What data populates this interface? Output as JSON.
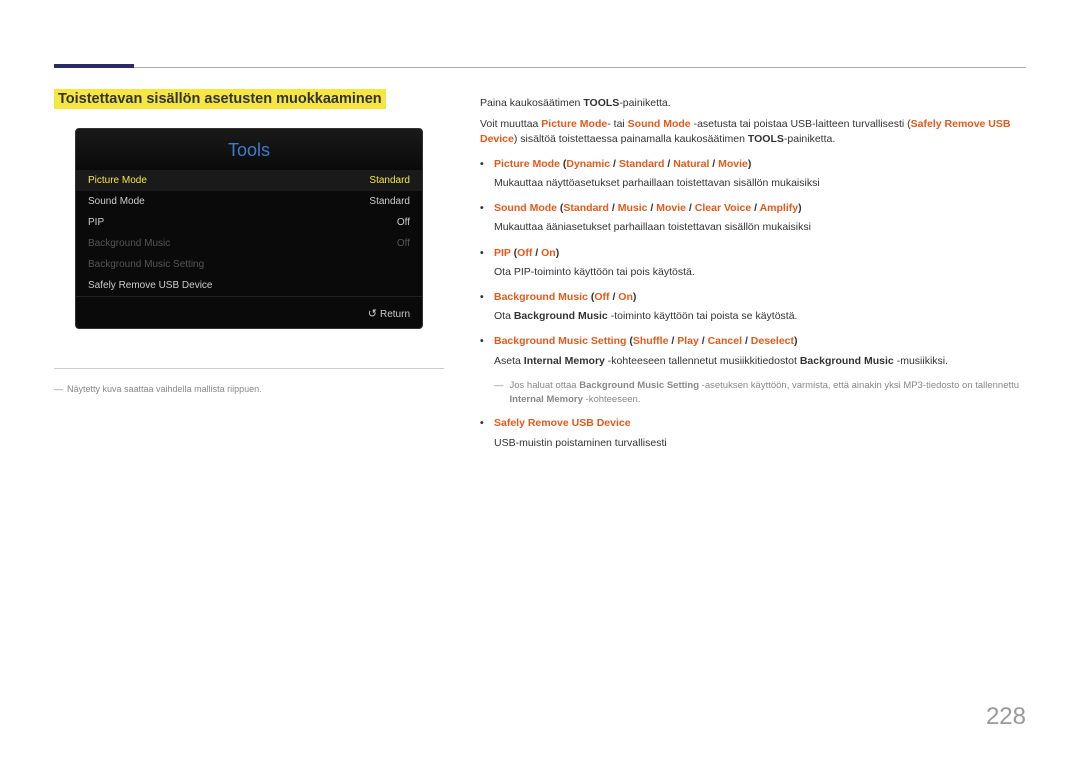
{
  "heading": "Toistettavan sisällön asetusten muokkaaminen",
  "tools": {
    "title": "Tools",
    "rows": [
      {
        "label": "Picture Mode",
        "value": "Standard",
        "cls": "highlight"
      },
      {
        "label": "Sound Mode",
        "value": "Standard",
        "cls": ""
      },
      {
        "label": "PIP",
        "value": "Off",
        "cls": ""
      },
      {
        "label": "Background Music",
        "value": "Off",
        "cls": "dim"
      },
      {
        "label": "Background Music Setting",
        "value": "",
        "cls": "dim"
      },
      {
        "label": "Safely Remove USB Device",
        "value": "",
        "cls": ""
      }
    ],
    "return": "Return"
  },
  "footnote_left": "Näytetty kuva saattaa vaihdella mallista riippuen.",
  "intro": {
    "l1a": "Paina kaukosäätimen ",
    "l1b": "TOOLS",
    "l1c": "-painiketta.",
    "l2a": "Voit muuttaa ",
    "l2b": "Picture Mode",
    "l2c": "- tai ",
    "l2d": "Sound Mode",
    "l2e": " -asetusta tai poistaa USB-laitteen turvallisesti (",
    "l2f": "Safely Remove USB Device",
    "l2g": ") sisältöä toistettaessa painamalla kaukosäätimen ",
    "l2h": "TOOLS",
    "l2i": "-painiketta."
  },
  "bullets": {
    "b1": {
      "t1": "Picture Mode",
      "p1": " (",
      "t2": "Dynamic",
      "s1": " / ",
      "t3": "Standard",
      "s2": " / ",
      "t4": "Natural",
      "s3": " / ",
      "t5": "Movie",
      "p2": ")",
      "sub": "Mukauttaa näyttöasetukset parhaillaan toistettavan sisällön mukaisiksi"
    },
    "b2": {
      "t1": "Sound Mode",
      "p1": " (",
      "t2": "Standard",
      "s1": " / ",
      "t3": "Music",
      "s2": " / ",
      "t4": "Movie",
      "s3": " / ",
      "t5": "Clear Voice",
      "s4": " / ",
      "t6": "Amplify",
      "p2": ")",
      "sub": "Mukauttaa ääniasetukset parhaillaan toistettavan sisällön mukaisiksi"
    },
    "b3": {
      "t1": "PIP",
      "p1": " (",
      "t2": "Off",
      "s1": " / ",
      "t3": "On",
      "p2": ")",
      "sub": "Ota PIP-toiminto käyttöön tai pois käytöstä."
    },
    "b4": {
      "t1": "Background Music",
      "p1": " (",
      "t2": "Off",
      "s1": " / ",
      "t3": "On",
      "p2": ")",
      "suba": "Ota ",
      "subb": "Background Music",
      "subc": " -toiminto käyttöön tai poista se käytöstä."
    },
    "b5": {
      "t1": "Background Music Setting",
      "p1": " (",
      "t2": "Shuffle",
      "s1": " / ",
      "t3": "Play",
      "s2": " / ",
      "t4": "Cancel",
      "s3": " / ",
      "t5": "Deselect",
      "p2": ")",
      "suba": "Aseta ",
      "subb": "Internal Memory",
      "subc": " -kohteeseen tallennetut musiikkitiedostot ",
      "subd": "Background Music",
      "sube": " -musiikiksi."
    },
    "dash": {
      "a": "Jos haluat ottaa ",
      "b": "Background Music Setting",
      "c": " -asetuksen käyttöön, varmista, että ainakin yksi MP3-tiedosto on tallennettu ",
      "d": "Internal Memory",
      "e": " -kohteeseen."
    },
    "b6": {
      "t1": "Safely Remove USB Device",
      "sub": "USB-muistin poistaminen turvallisesti"
    }
  },
  "page_number": "228"
}
